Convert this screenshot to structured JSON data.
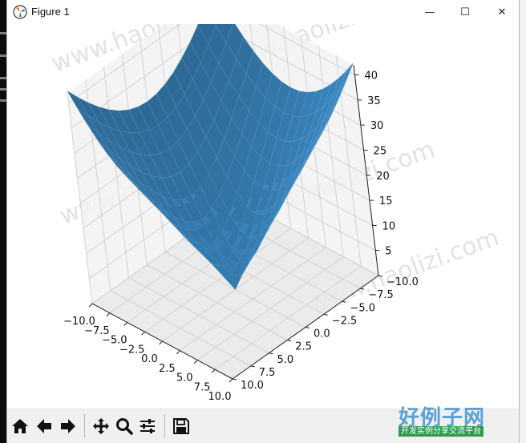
{
  "window": {
    "title": "Figure 1",
    "minimize_glyph": "—",
    "maximize_glyph": "☐",
    "close_glyph": "✕"
  },
  "toolbar": {
    "buttons": [
      {
        "name": "home-icon",
        "label": "Home"
      },
      {
        "name": "back-icon",
        "label": "Back"
      },
      {
        "name": "forward-icon",
        "label": "Forward"
      },
      {
        "name": "pan-icon",
        "label": "Pan"
      },
      {
        "name": "zoom-icon",
        "label": "Zoom"
      },
      {
        "name": "configure-subplots-icon",
        "label": "Configure subplots"
      },
      {
        "name": "save-icon",
        "label": "Save"
      }
    ]
  },
  "watermark": {
    "text": "www.haolizi.com",
    "logo_main": "好例子网",
    "logo_sub": "开发实例分享交流平台"
  },
  "colors": {
    "surface": "#3a86c0",
    "pane": "#f2f2f2",
    "grid": "#d2d2d2"
  },
  "chart_data": {
    "type": "surface",
    "title": "",
    "x_ticks": [
      "−10.0",
      "−7.5",
      "−5.0",
      "−2.5",
      "0.0",
      "2.5",
      "5.0",
      "7.5",
      "10.0"
    ],
    "y_ticks": [
      "−10.0",
      "−7.5",
      "−5.0",
      "−2.5",
      "0.0",
      "2.5",
      "5.0",
      "7.5",
      "10.0"
    ],
    "z_ticks": [
      "5",
      "10",
      "15",
      "20",
      "25",
      "30",
      "35",
      "40"
    ],
    "xlim": [
      -10,
      10
    ],
    "ylim": [
      -10,
      10
    ],
    "zlim": [
      0,
      42
    ],
    "grid": true
  }
}
